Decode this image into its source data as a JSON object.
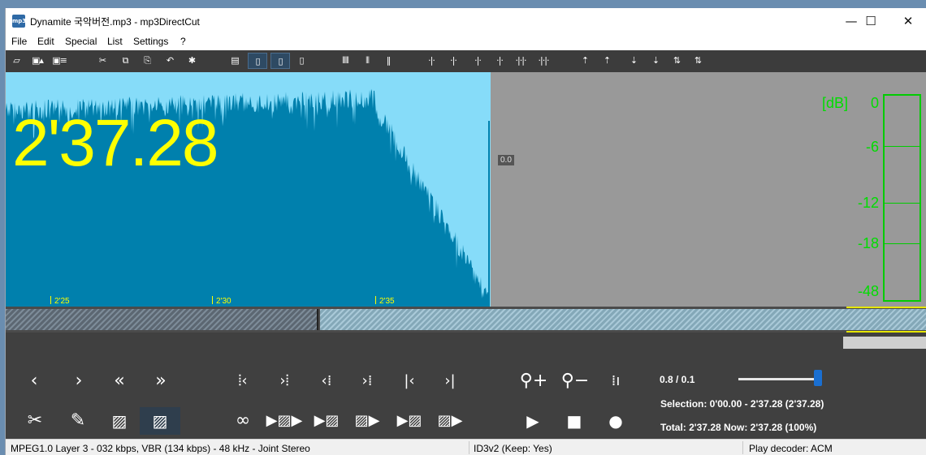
{
  "window": {
    "app_icon_text": "mp3",
    "title": "Dynamite 국악버전.mp3 - mp3DirectCut",
    "controls": {
      "minimize": "—",
      "maximize": "☐",
      "close": "✕"
    }
  },
  "menu": [
    "File",
    "Edit",
    "Special",
    "List",
    "Settings",
    "?"
  ],
  "toolbar_icons": [
    "open-icon",
    "save-icon",
    "save-as-icon",
    "cut-icon",
    "copy-icon",
    "paste-icon",
    "undo-icon",
    "settings-icon",
    "page-icon",
    "page-1-icon",
    "page-2-icon",
    "page-3-icon",
    "marker-a-icon",
    "marker-b-icon",
    "pause-marker-icon",
    "cue-icon-1",
    "cue-icon-2",
    "cue-icon-3",
    "cue-icon-4",
    "cue-icon-5",
    "cue-icon-6",
    "edit-icon-1",
    "edit-icon-2",
    "edit-icon-3",
    "edit-icon-4",
    "edit-icon-5"
  ],
  "waveform": {
    "time_display": "2'37.28",
    "ruler_marks": [
      "2'25",
      "2'30",
      "2'35"
    ],
    "position_badge": "0.0",
    "colors": {
      "background": "#86dcf9",
      "wave": "#0080ad",
      "time": "#ffff00"
    }
  },
  "db_meter": {
    "unit": "[dB]",
    "labels": [
      "0",
      "-6",
      "-12",
      "-18",
      "-48"
    ],
    "color": "#00dd00"
  },
  "controls": {
    "row1_icons": [
      "prev-icon",
      "next-icon",
      "rewind-icon",
      "fast-forward-icon",
      "sel-start-left-icon",
      "sel-end-right-icon",
      "cue-prev-icon",
      "cue-next-icon",
      "go-start-icon",
      "go-end-icon",
      "zoom-in-icon",
      "zoom-out-icon",
      "volume-level-icon"
    ],
    "row2_icons": [
      "scissors-icon",
      "pencil-icon",
      "fade-in-icon",
      "fade-out-icon",
      "loop-icon",
      "play-selection-icon",
      "play-sel-end-icon",
      "play-sel-start-icon",
      "play-to-end-icon",
      "play-from-start-icon",
      "play-icon",
      "stop-icon",
      "record-icon"
    ],
    "zoom_ratio": "0.8  /  0.1",
    "selection": "Selection: 0'00.00 - 2'37.28 (2'37.28)",
    "total": "Total: 2'37.28   Now: 2'37.28   (100%)",
    "slider_value": 0.95
  },
  "status": {
    "format": "MPEG1.0 Layer 3 - 032 kbps, VBR (134 kbps) - 48 kHz - Joint Stereo",
    "id3": "ID3v2 (Keep: Yes)",
    "decoder": "Play decoder: ACM"
  }
}
